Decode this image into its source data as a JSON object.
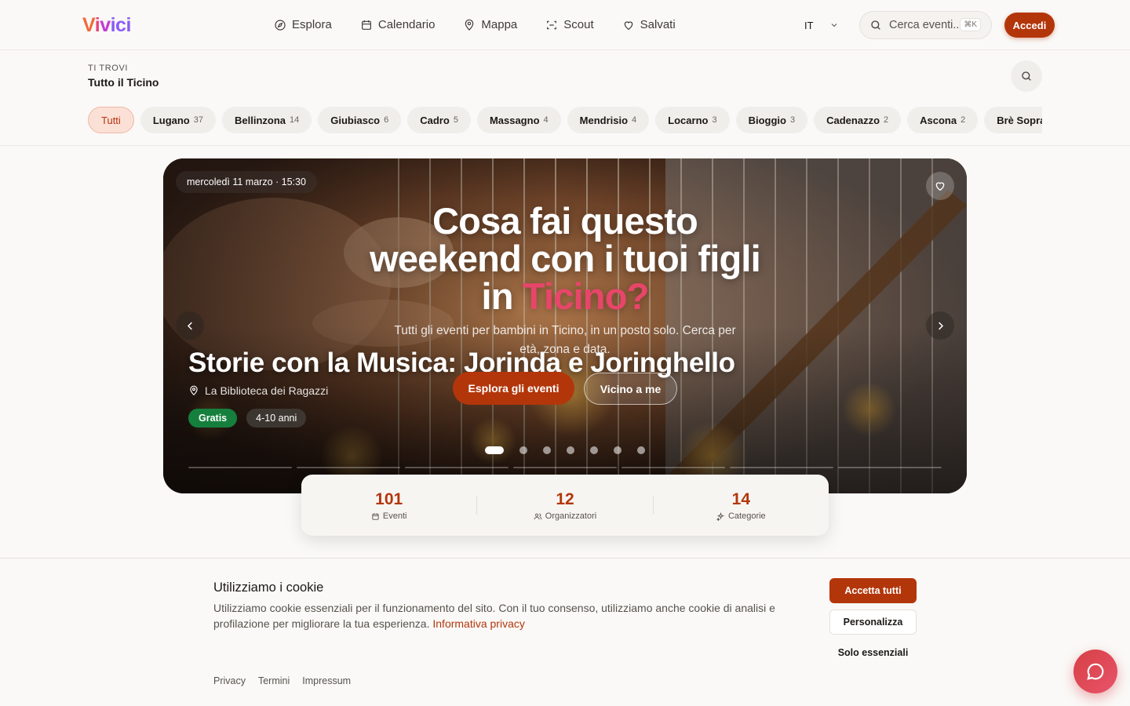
{
  "header": {
    "logo": {
      "parts": [
        "V",
        "i",
        "v",
        "ici"
      ]
    },
    "nav": [
      {
        "label": "Esplora",
        "icon": "compass-icon"
      },
      {
        "label": "Calendario",
        "icon": "calendar-icon"
      },
      {
        "label": "Mappa",
        "icon": "map-pin-icon"
      },
      {
        "label": "Scout",
        "icon": "scan-icon"
      },
      {
        "label": "Salvati",
        "icon": "heart-icon"
      }
    ],
    "language": "IT",
    "search_placeholder": "Cerca eventi...",
    "search_shortcut": "⌘K",
    "login_label": "Accedi"
  },
  "location": {
    "label": "TI TROVI",
    "value": "Tutto il Ticino",
    "chips": [
      {
        "label": "Tutti",
        "count": ""
      },
      {
        "label": "Lugano",
        "count": "37"
      },
      {
        "label": "Bellinzona",
        "count": "14"
      },
      {
        "label": "Giubiasco",
        "count": "6"
      },
      {
        "label": "Cadro",
        "count": "5"
      },
      {
        "label": "Massagno",
        "count": "4"
      },
      {
        "label": "Mendrisio",
        "count": "4"
      },
      {
        "label": "Locarno",
        "count": "3"
      },
      {
        "label": "Bioggio",
        "count": "3"
      },
      {
        "label": "Cadenazzo",
        "count": "2"
      },
      {
        "label": "Ascona",
        "count": "2"
      },
      {
        "label": "Brè Sopra Lugano",
        "count": ""
      }
    ]
  },
  "hero": {
    "date": "mercoledì 11 marzo · 15:30",
    "headline_main": "Cosa fai questo weekend con i tuoi figli in ",
    "headline_highlight": "Ticino?",
    "subtitle": "Tutti gli eventi per bambini in Ticino, in un posto solo. Cerca per età, zona e data.",
    "event_title": "Storie con la Musica: Jorinda e Joringhello",
    "venue": "La Biblioteca dei Ragazzi",
    "price_tag": "Gratis",
    "age_tag": "4-10 anni",
    "cta_primary": "Esplora gli eventi",
    "cta_secondary": "Vicino a me",
    "slide_count": 7,
    "active_slide": 1
  },
  "stats": [
    {
      "value": "101",
      "label": "Eventi",
      "icon": "calendar-icon"
    },
    {
      "value": "12",
      "label": "Organizzatori",
      "icon": "users-icon"
    },
    {
      "value": "14",
      "label": "Categorie",
      "icon": "sparkles-icon"
    }
  ],
  "cookie": {
    "title": "Utilizziamo i cookie",
    "text": "Utilizziamo cookie essenziali per il funzionamento del sito. Con il tuo consenso, utilizziamo anche cookie di analisi e profilazione per migliorare la tua esperienza.",
    "privacy_link": "Informativa privacy",
    "accept_all": "Accetta tutti",
    "customize": "Personalizza",
    "essential_only": "Solo essenziali"
  },
  "footer": {
    "links": [
      "Privacy",
      "Termini",
      "Impressum"
    ]
  },
  "colors": {
    "accent": "#b3360b",
    "highlight": "#e8456a",
    "free": "#15803d"
  }
}
